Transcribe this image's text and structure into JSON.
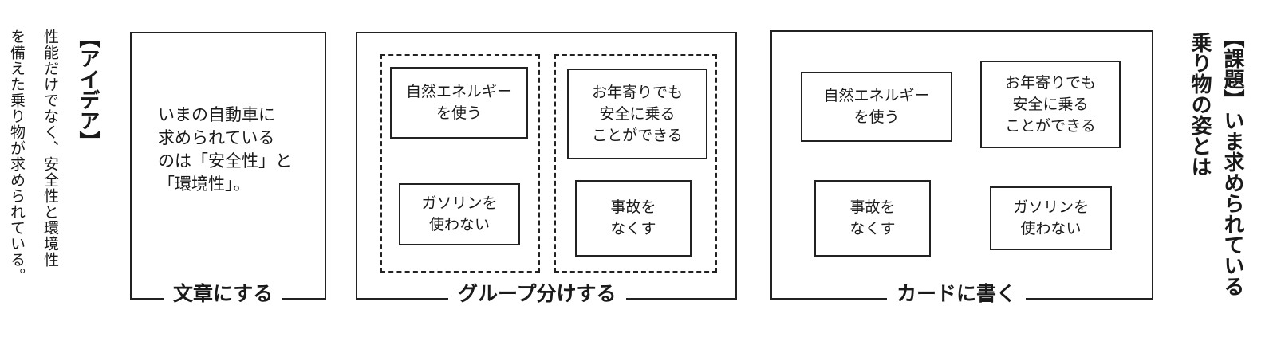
{
  "idea": {
    "title": "【アイデア】",
    "body_col1": "性能だけでなく、安全性と環境性",
    "body_col2": "を備えた乗り物が求められている。"
  },
  "issue": {
    "title": "【課題】いま求められている",
    "title_col2": "乗り物の姿とは"
  },
  "panels": [
    {
      "caption": "文章にする",
      "text": "いまの自動車に\n求められている\nのは「安全性」と\n「環境性」。"
    },
    {
      "caption": "グループ分けする",
      "cards": [
        "自然エネルギー\nを使う",
        "お年寄りでも\n安全に乗る\nことができる",
        "ガソリンを\n使わない",
        "事故を\nなくす"
      ]
    },
    {
      "caption": "カードに書く",
      "cards": [
        "自然エネルギー\nを使う",
        "お年寄りでも\n安全に乗る\nことができる",
        "事故を\nなくす",
        "ガソリンを\n使わない"
      ]
    }
  ]
}
